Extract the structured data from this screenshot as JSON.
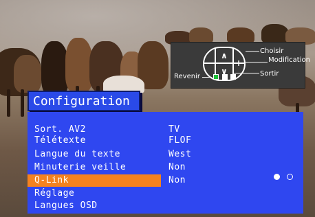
{
  "hint_panel": {
    "choisir": "Choisir",
    "modification": "Modification",
    "revenir": "Revenir",
    "sortir": "Sortir",
    "button_up": "∧",
    "button_down": "∨",
    "button_left": "−",
    "button_right": "+",
    "colors": {
      "green": "#1fbf3a",
      "white": "#ffffff",
      "panel": "#3a3a3a"
    }
  },
  "menu": {
    "title": "Configuration",
    "items": [
      {
        "label": "Sort. AV2",
        "value": "TV"
      },
      {
        "label": "Télétexte",
        "value": "FLOF"
      },
      {
        "label": "Langue du texte",
        "value": "West"
      },
      {
        "label": "Minuterie veille",
        "value": "Non"
      },
      {
        "label": "Q-Link",
        "value": "Non",
        "selected": true
      },
      {
        "label": "Réglage",
        "value": ""
      },
      {
        "label": "Langues OSD",
        "value": ""
      }
    ],
    "colors": {
      "panel": "#2f47f0",
      "highlight": "#f5821f",
      "text": "#ffffff"
    }
  },
  "page_indicator": {
    "total": 2,
    "active": 1
  }
}
